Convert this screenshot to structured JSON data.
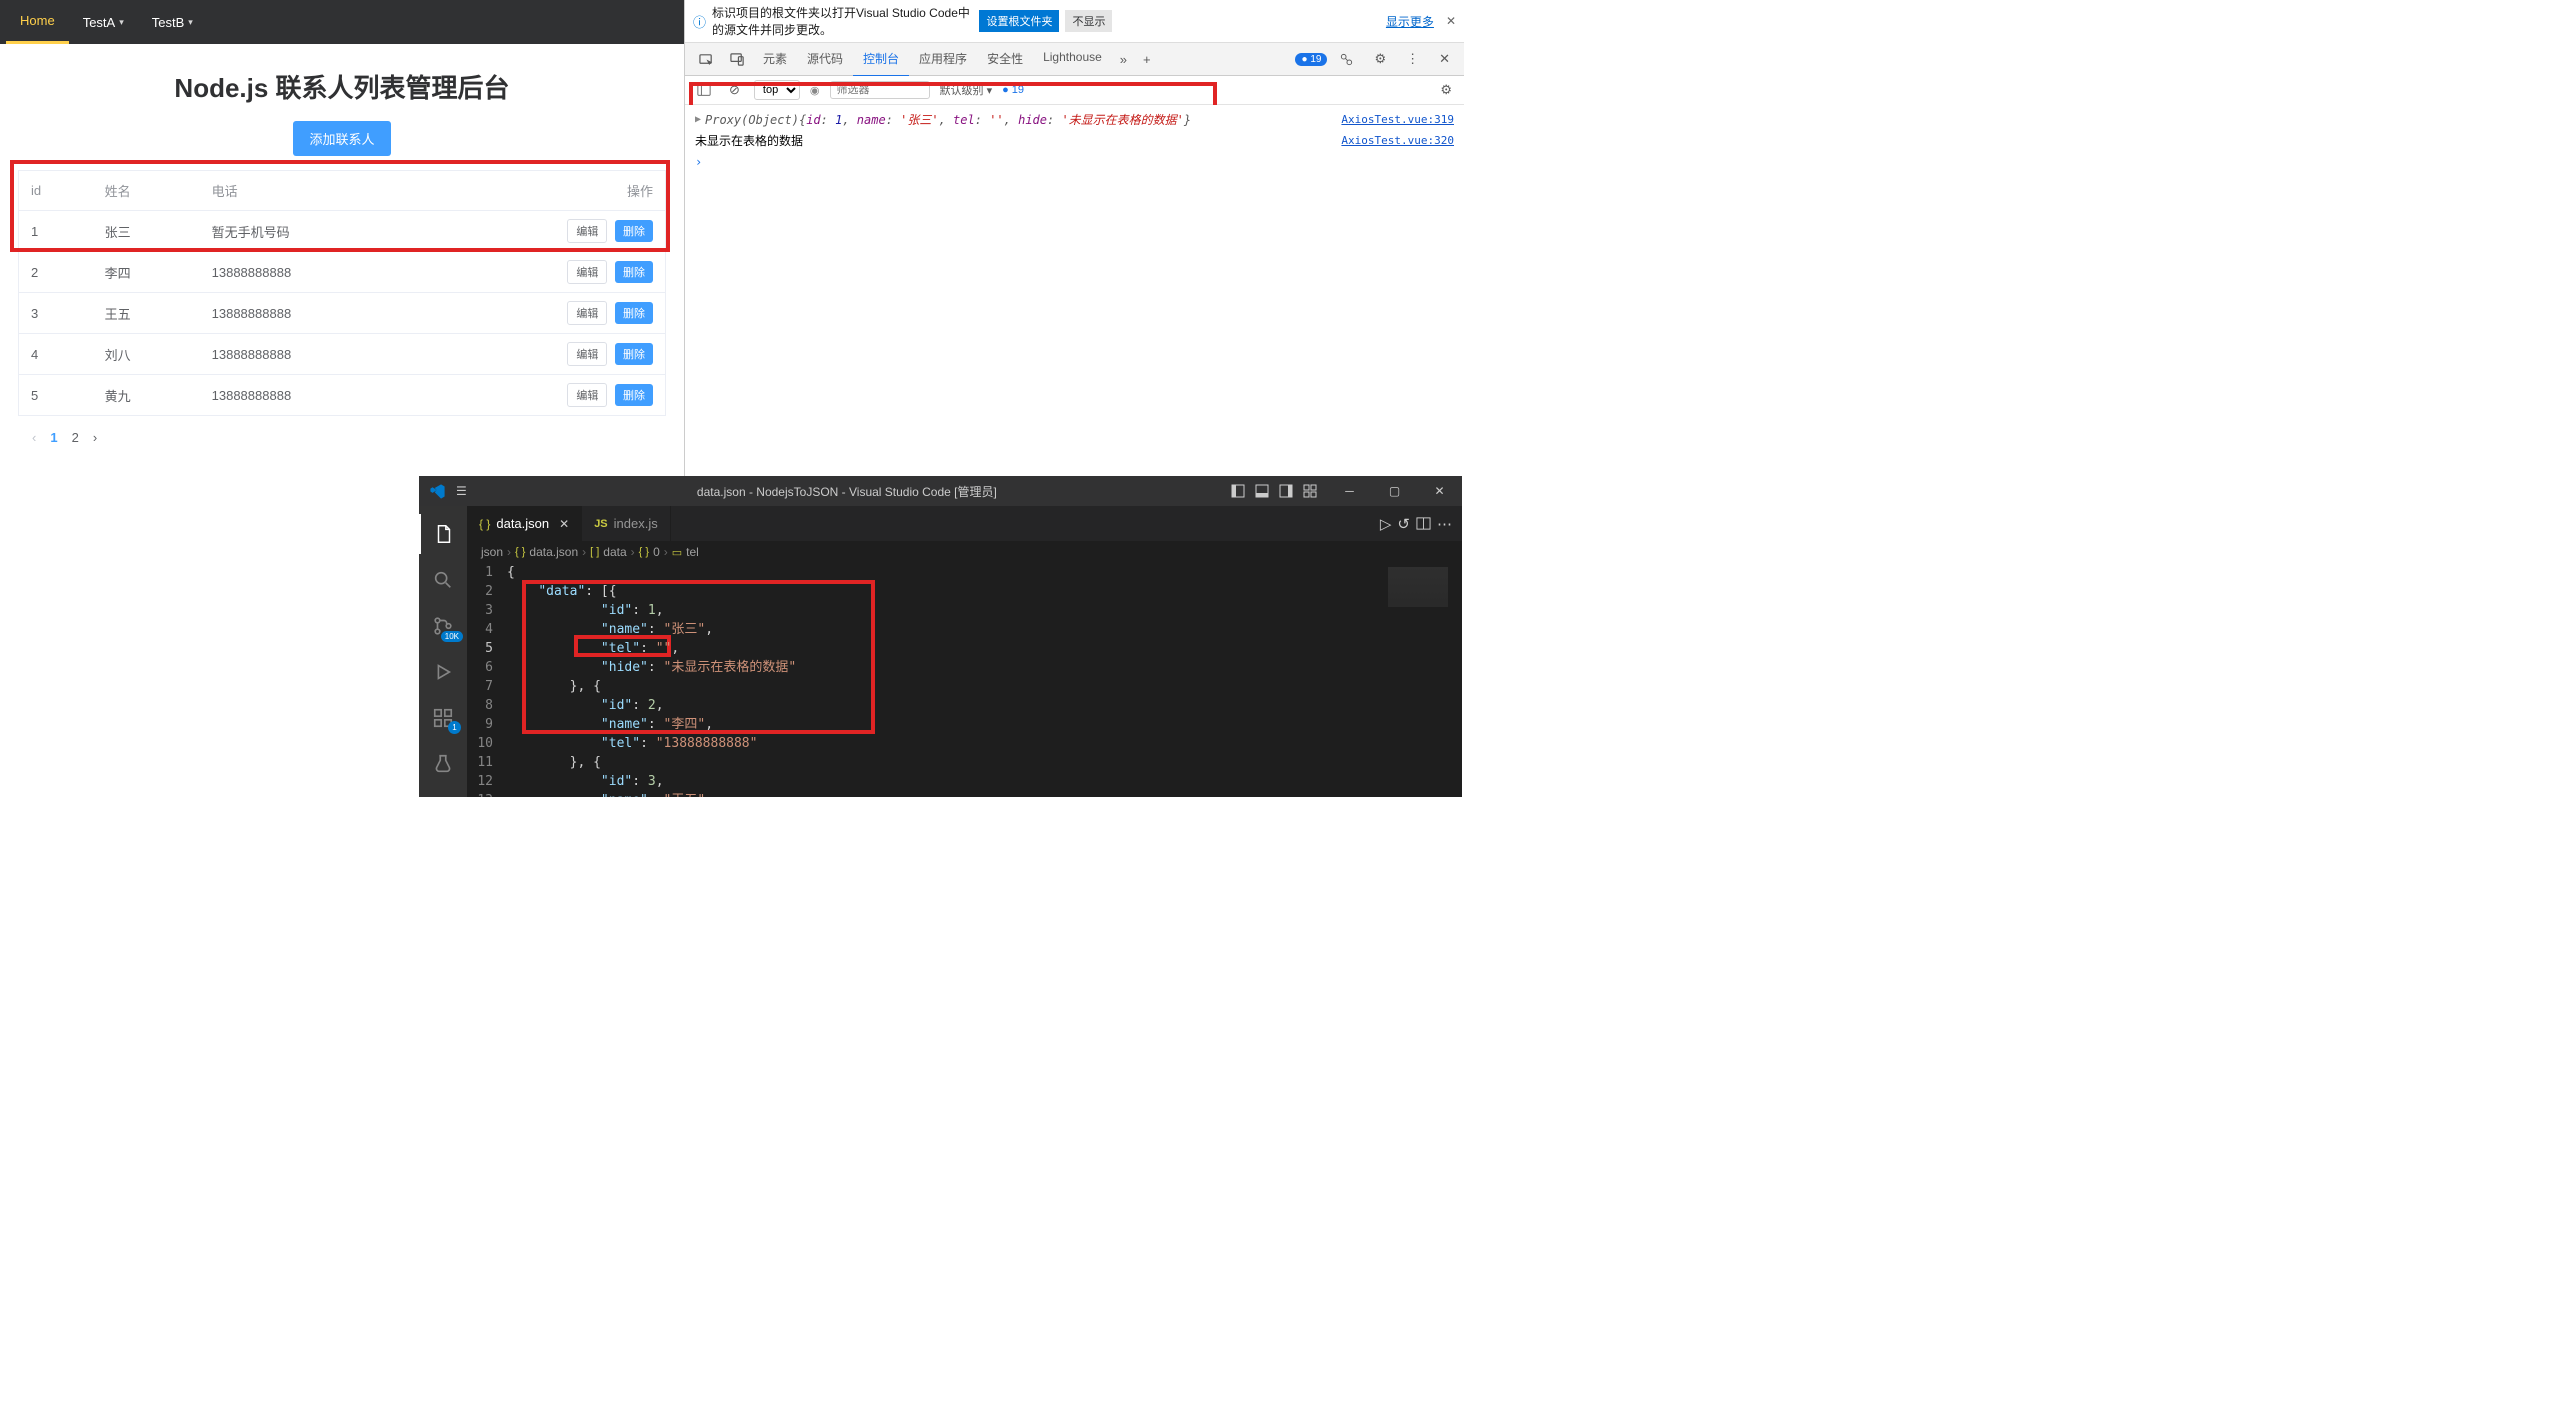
{
  "app": {
    "nav": [
      {
        "label": "Home",
        "active": true
      },
      {
        "label": "TestA",
        "dropdown": true
      },
      {
        "label": "TestB",
        "dropdown": true
      }
    ],
    "title": "Node.js 联系人列表管理后台",
    "add_button": "添加联系人",
    "columns": [
      "id",
      "姓名",
      "电话",
      "操作"
    ],
    "rows": [
      {
        "id": "1",
        "name": "张三",
        "tel": "暂无手机号码"
      },
      {
        "id": "2",
        "name": "李四",
        "tel": "13888888888"
      },
      {
        "id": "3",
        "name": "王五",
        "tel": "13888888888"
      },
      {
        "id": "4",
        "name": "刘八",
        "tel": "13888888888"
      },
      {
        "id": "5",
        "name": "黄九",
        "tel": "13888888888"
      }
    ],
    "edit_btn": "编辑",
    "del_btn": "删除",
    "pager": {
      "prev": "‹",
      "pages": [
        "1",
        "2"
      ],
      "next": "›",
      "active": 0
    }
  },
  "notification": {
    "text": "标识项目的根文件夹以打开Visual Studio Code中的源文件并同步更改。",
    "btn_set": "设置根文件夹",
    "btn_no": "不显示",
    "link_more": "显示更多"
  },
  "devtools": {
    "tabs": [
      "元素",
      "源代码",
      "控制台",
      "应用程序",
      "安全性",
      "Lighthouse"
    ],
    "active_tab": 2,
    "msg_count": "19",
    "filter": {
      "top": "top",
      "filter_placeholder": "筛选器",
      "level": "默认级别",
      "issues": "19"
    },
    "console": [
      {
        "expand": true,
        "prefix": "Proxy(Object)",
        "body_parts": [
          {
            "t": "brace",
            "v": "{"
          },
          {
            "t": "key",
            "v": "id"
          },
          {
            "t": "plain",
            "v": ": "
          },
          {
            "t": "num",
            "v": "1"
          },
          {
            "t": "plain",
            "v": ", "
          },
          {
            "t": "key",
            "v": "name"
          },
          {
            "t": "plain",
            "v": ": "
          },
          {
            "t": "str",
            "v": "'张三'"
          },
          {
            "t": "plain",
            "v": ", "
          },
          {
            "t": "key",
            "v": "tel"
          },
          {
            "t": "plain",
            "v": ": "
          },
          {
            "t": "str",
            "v": "''"
          },
          {
            "t": "plain",
            "v": ", "
          },
          {
            "t": "key",
            "v": "hide"
          },
          {
            "t": "plain",
            "v": ": "
          },
          {
            "t": "str",
            "v": "'未显示在表格的数据'"
          },
          {
            "t": "brace",
            "v": "}"
          }
        ],
        "link": "AxiosTest.vue:319"
      },
      {
        "text": "未显示在表格的数据",
        "link": "AxiosTest.vue:320"
      }
    ]
  },
  "vscode": {
    "title": "data.json - NodejsToJSON - Visual Studio Code [管理员]",
    "tabs": [
      {
        "name": "data.json",
        "kind": "json",
        "active": true
      },
      {
        "name": "index.js",
        "kind": "js"
      }
    ],
    "breadcrumb": [
      "json",
      "data.json",
      "data",
      "0",
      "tel"
    ],
    "scm_badge": "10K",
    "ext_badge": "1",
    "code": {
      "start": 1,
      "current": 5,
      "lines": [
        [
          {
            "t": "brace",
            "v": "{"
          }
        ],
        [
          {
            "t": "indent",
            "v": "    "
          },
          {
            "t": "key",
            "v": "\"data\""
          },
          {
            "t": "plain",
            "v": ": ["
          },
          {
            "t": "brace",
            "v": "{"
          }
        ],
        [
          {
            "t": "indent",
            "v": "            "
          },
          {
            "t": "key",
            "v": "\"id\""
          },
          {
            "t": "plain",
            "v": ": "
          },
          {
            "t": "num",
            "v": "1"
          },
          {
            "t": "plain",
            "v": ","
          }
        ],
        [
          {
            "t": "indent",
            "v": "            "
          },
          {
            "t": "key",
            "v": "\"name\""
          },
          {
            "t": "plain",
            "v": ": "
          },
          {
            "t": "str",
            "v": "\"张三\""
          },
          {
            "t": "plain",
            "v": ","
          }
        ],
        [
          {
            "t": "indent",
            "v": "            "
          },
          {
            "t": "key",
            "v": "\"tel\""
          },
          {
            "t": "plain",
            "v": ": "
          },
          {
            "t": "str",
            "v": "\"\""
          },
          {
            "t": "plain",
            "v": ","
          }
        ],
        [
          {
            "t": "indent",
            "v": "            "
          },
          {
            "t": "key",
            "v": "\"hide\""
          },
          {
            "t": "plain",
            "v": ": "
          },
          {
            "t": "str",
            "v": "\"未显示在表格的数据\""
          }
        ],
        [
          {
            "t": "indent",
            "v": "        "
          },
          {
            "t": "brace",
            "v": "}"
          },
          {
            "t": "plain",
            "v": ", "
          },
          {
            "t": "brace",
            "v": "{"
          }
        ],
        [
          {
            "t": "indent",
            "v": "            "
          },
          {
            "t": "key",
            "v": "\"id\""
          },
          {
            "t": "plain",
            "v": ": "
          },
          {
            "t": "num",
            "v": "2"
          },
          {
            "t": "plain",
            "v": ","
          }
        ],
        [
          {
            "t": "indent",
            "v": "            "
          },
          {
            "t": "key",
            "v": "\"name\""
          },
          {
            "t": "plain",
            "v": ": "
          },
          {
            "t": "str",
            "v": "\"李四\""
          },
          {
            "t": "plain",
            "v": ","
          }
        ],
        [
          {
            "t": "indent",
            "v": "            "
          },
          {
            "t": "key",
            "v": "\"tel\""
          },
          {
            "t": "plain",
            "v": ": "
          },
          {
            "t": "str",
            "v": "\"13888888888\""
          }
        ],
        [
          {
            "t": "indent",
            "v": "        "
          },
          {
            "t": "brace",
            "v": "}"
          },
          {
            "t": "plain",
            "v": ", "
          },
          {
            "t": "brace",
            "v": "{"
          }
        ],
        [
          {
            "t": "indent",
            "v": "            "
          },
          {
            "t": "key",
            "v": "\"id\""
          },
          {
            "t": "plain",
            "v": ": "
          },
          {
            "t": "num",
            "v": "3"
          },
          {
            "t": "plain",
            "v": ","
          }
        ],
        [
          {
            "t": "indent",
            "v": "            "
          },
          {
            "t": "key",
            "v": "\"name\""
          },
          {
            "t": "plain",
            "v": ": "
          },
          {
            "t": "str",
            "v": "\"王五\""
          },
          {
            "t": "plain",
            "v": ","
          }
        ]
      ]
    }
  }
}
